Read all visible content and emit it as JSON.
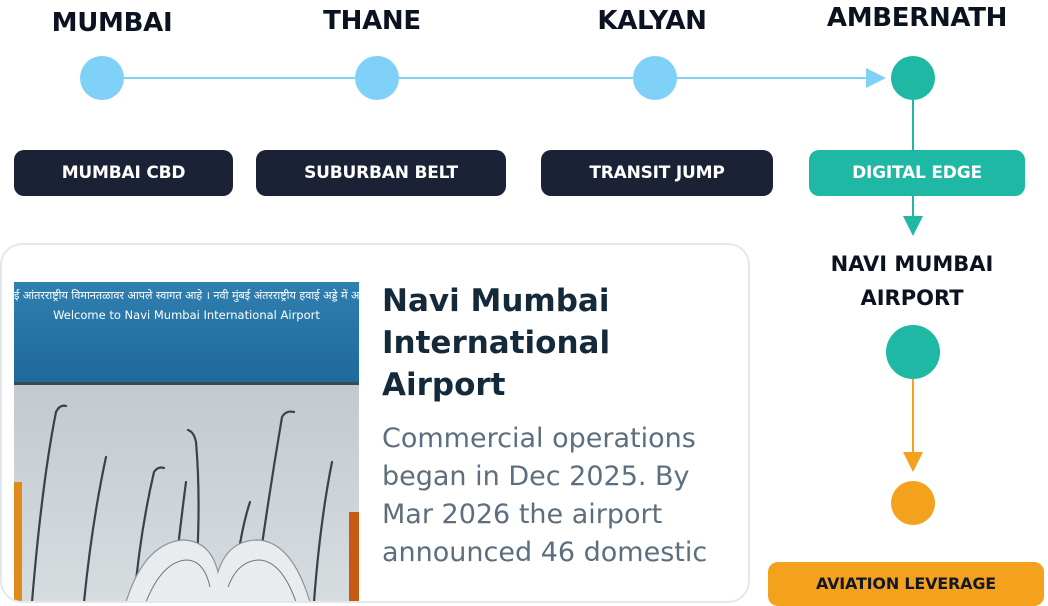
{
  "timeline": {
    "stops": [
      {
        "city": "MUMBAI",
        "tag": "MUMBAI CBD"
      },
      {
        "city": "THANE",
        "tag": "SUBURBAN BELT"
      },
      {
        "city": "KALYAN",
        "tag": "TRANSIT JUMP"
      },
      {
        "city": "AMBERNATH",
        "tag": "DIGITAL EDGE"
      }
    ]
  },
  "branch": {
    "label_lines": [
      "NAVI MUMBAI",
      "AIRPORT"
    ],
    "final_tag": "AVIATION LEVERAGE"
  },
  "card": {
    "title_lines": [
      "Navi Mumbai",
      "International",
      "Airport"
    ],
    "body_lines": [
      "Commercial operations",
      "began in Dec 2025. By",
      "Mar 2026 the airport",
      "announced 46 domestic"
    ],
    "image": {
      "sign_text_regional": "ई आंतरराष्ट्रीय विमानतळावर आपले स्वागत आहे । नवी मुंबई अंतरराष्ट्रीय हवाई अड्डे में आपका स्वा",
      "sign_text_english": "Welcome to Navi Mumbai International Airport"
    }
  },
  "colors": {
    "light_blue": "#7fd1f7",
    "teal": "#1fb8a4",
    "orange": "#f4a11d",
    "dark_pill": "#1b2235"
  }
}
